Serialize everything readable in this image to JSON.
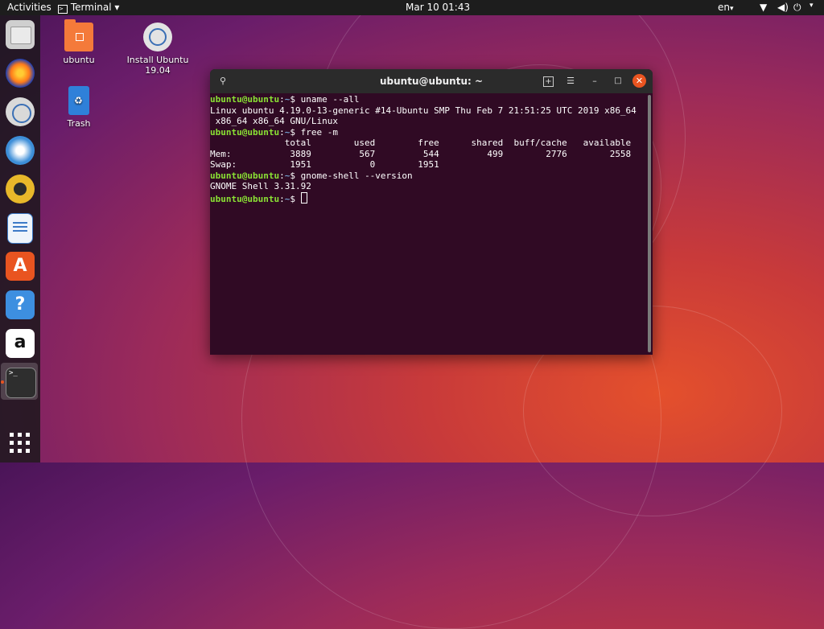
{
  "topbar": {
    "activities": "Activities",
    "app_menu": "Terminal",
    "clock": "Mar 10  01:43",
    "language": "en"
  },
  "desktop_icons": [
    {
      "label": "ubuntu"
    },
    {
      "label_line1": "Install Ubuntu",
      "label_line2": "19.04"
    },
    {
      "label": "Trash"
    }
  ],
  "terminal": {
    "title": "ubuntu@ubuntu: ~",
    "user_host": "ubuntu@ubuntu",
    "path": "~",
    "lines": [
      {
        "cmd": "uname --all"
      },
      {
        "out": "Linux ubuntu 4.19.0-13-generic #14-Ubuntu SMP Thu Feb 7 21:51:25 UTC 2019 x86_64"
      },
      {
        "out": " x86_64 x86_64 GNU/Linux"
      },
      {
        "cmd": "free -m"
      },
      {
        "out": "              total        used        free      shared  buff/cache   available"
      },
      {
        "out": "Mem:           3889         567         544         499        2776        2558"
      },
      {
        "out": "Swap:          1951           0        1951"
      },
      {
        "cmd": "gnome-shell --version"
      },
      {
        "out": "GNOME Shell 3.31.92"
      },
      {
        "cmd": ""
      }
    ]
  }
}
